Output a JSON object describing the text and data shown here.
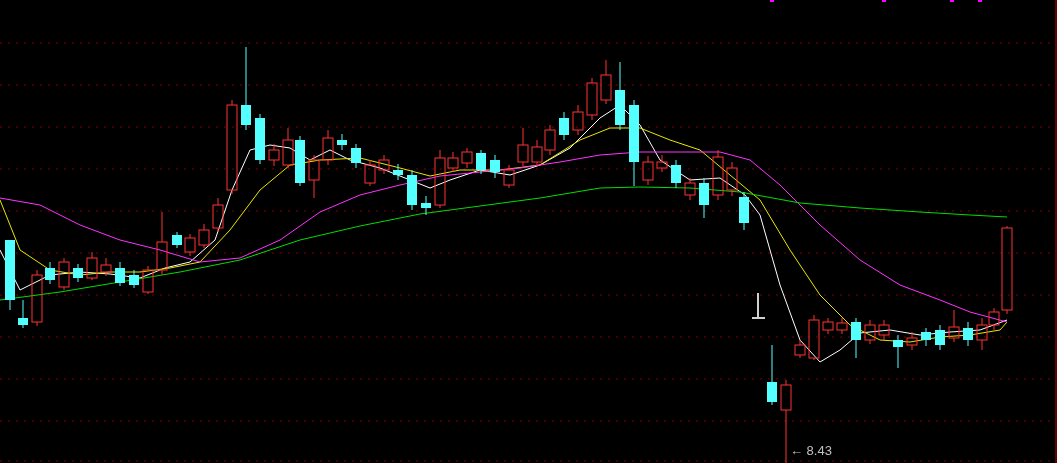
{
  "chart": {
    "low_label": "← 8.43"
  }
}
